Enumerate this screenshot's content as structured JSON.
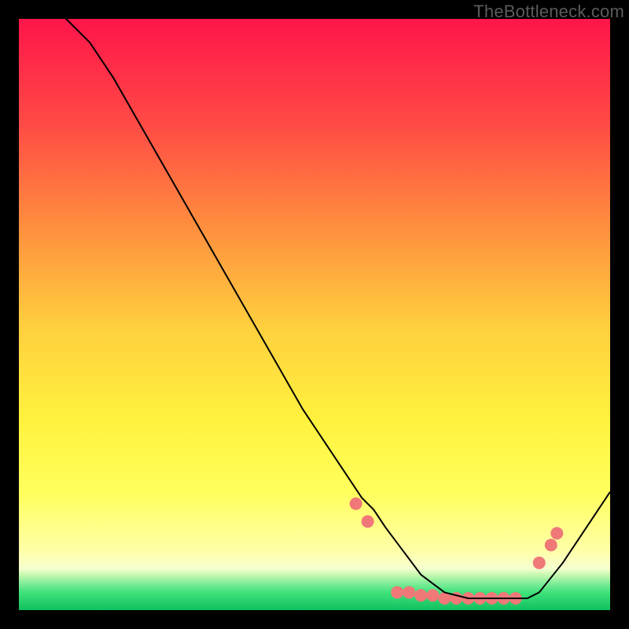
{
  "watermark": "TheBottleneck.com",
  "chart_data": {
    "type": "line",
    "title": "",
    "xlabel": "",
    "ylabel": "",
    "xlim": [
      0,
      100
    ],
    "ylim": [
      0,
      100
    ],
    "grid": false,
    "legend": false,
    "background_gradient": {
      "top_color": "#ff154a",
      "mid_color_1": "#ff7a3a",
      "mid_color_2": "#ffd53a",
      "mid_color_3": "#ffff3a",
      "lower_color": "#ffffb0",
      "band_color": "#3fe27a",
      "bottom_color": "#10c060"
    },
    "series": [
      {
        "name": "curve",
        "color": "#000000",
        "width": 2,
        "x": [
          0,
          4,
          8,
          12,
          16,
          20,
          24,
          28,
          32,
          36,
          40,
          44,
          48,
          52,
          56,
          58,
          60,
          62,
          65,
          68,
          72,
          76,
          80,
          82,
          84,
          86,
          88,
          92,
          96,
          100
        ],
        "y": [
          104,
          102,
          100,
          96,
          90,
          83,
          76,
          69,
          62,
          55,
          48,
          41,
          34,
          28,
          22,
          19,
          17,
          14,
          10,
          6,
          3,
          2,
          2,
          2,
          2,
          2,
          3,
          8,
          14,
          20
        ]
      }
    ],
    "marker_points": {
      "name": "dots",
      "color": "#f07878",
      "radius": 8,
      "points": [
        {
          "x": 57,
          "y": 18
        },
        {
          "x": 59,
          "y": 15
        },
        {
          "x": 64,
          "y": 3
        },
        {
          "x": 66,
          "y": 3
        },
        {
          "x": 68,
          "y": 2.5
        },
        {
          "x": 70,
          "y": 2.5
        },
        {
          "x": 72,
          "y": 2
        },
        {
          "x": 74,
          "y": 2
        },
        {
          "x": 76,
          "y": 2
        },
        {
          "x": 78,
          "y": 2
        },
        {
          "x": 80,
          "y": 2
        },
        {
          "x": 82,
          "y": 2
        },
        {
          "x": 84,
          "y": 2
        },
        {
          "x": 88,
          "y": 8
        },
        {
          "x": 90,
          "y": 11
        },
        {
          "x": 91,
          "y": 13
        }
      ]
    }
  }
}
